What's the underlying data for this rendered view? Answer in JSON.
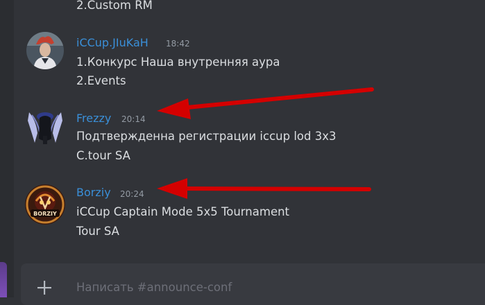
{
  "messages": [
    {
      "username": "",
      "time": "",
      "lines": [
        "2.Custom RM"
      ]
    },
    {
      "username": "iCCup.JIuKaH",
      "time": "18:42",
      "lines": [
        "1.Конкурс Наша внутренняя аура",
        "2.Events"
      ]
    },
    {
      "username": "Frezzy",
      "time": "20:14",
      "lines": [
        "Подтвержденна регистрации iccup lod 3x3",
        "C.tour SA"
      ]
    },
    {
      "username": "Borziy",
      "time": "20:24",
      "lines": [
        "iCCup Captain Mode 5x5 Tournament",
        "Tour SA"
      ]
    }
  ],
  "composer": {
    "placeholder": "Написать #announce-conf"
  },
  "avatar_labels": {
    "borziy": "BORZIY"
  },
  "colors": {
    "background": "#313338",
    "username": "#3a8fd8",
    "text": "#dbdee1",
    "timestamp": "#949ba4",
    "annotation_arrow": "#d40000"
  },
  "icons": [
    "plus-icon",
    "annotation-arrow"
  ]
}
